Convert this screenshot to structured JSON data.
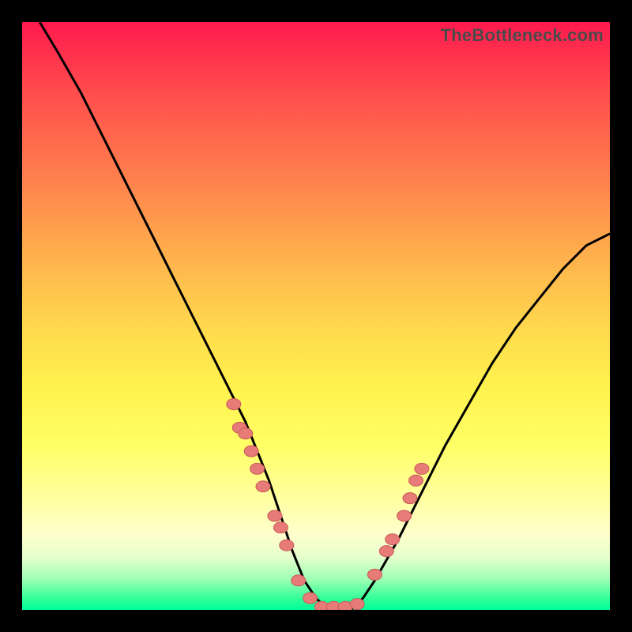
{
  "watermark": "TheBottleneck.com",
  "colors": {
    "curve": "#000000",
    "markers_fill": "#e77b78",
    "markers_stroke": "#c95a57"
  },
  "chart_data": {
    "type": "line",
    "title": "",
    "xlabel": "",
    "ylabel": "",
    "xlim": [
      0,
      100
    ],
    "ylim": [
      0,
      100
    ],
    "grid": false,
    "legend": null,
    "series": [
      {
        "name": "curve",
        "x": [
          3,
          6,
          10,
          14,
          18,
          22,
          26,
          30,
          34,
          38,
          42,
          44,
          46,
          48,
          50,
          52,
          54,
          56,
          58,
          60,
          64,
          68,
          72,
          76,
          80,
          84,
          88,
          92,
          96,
          100
        ],
        "y": [
          100,
          95,
          88,
          80,
          72,
          64,
          56,
          48,
          40,
          32,
          22,
          16,
          10,
          5,
          2,
          0,
          0,
          0,
          2,
          5,
          12,
          20,
          28,
          35,
          42,
          48,
          53,
          58,
          62,
          64
        ],
        "note": "Approximate shape of the V-curve read from the figure; x and y in percent of axis range."
      }
    ],
    "marker_clusters": [
      {
        "name": "left_cluster",
        "points": [
          {
            "x": 36,
            "y": 35
          },
          {
            "x": 37,
            "y": 31
          },
          {
            "x": 38,
            "y": 30
          },
          {
            "x": 39,
            "y": 27
          },
          {
            "x": 40,
            "y": 24
          },
          {
            "x": 41,
            "y": 21
          },
          {
            "x": 43,
            "y": 16
          },
          {
            "x": 44,
            "y": 14
          },
          {
            "x": 45,
            "y": 11
          }
        ]
      },
      {
        "name": "bottom_cluster",
        "points": [
          {
            "x": 47,
            "y": 5
          },
          {
            "x": 49,
            "y": 2
          },
          {
            "x": 51,
            "y": 0.5
          },
          {
            "x": 53,
            "y": 0.5
          },
          {
            "x": 55,
            "y": 0.5
          },
          {
            "x": 57,
            "y": 1
          }
        ]
      },
      {
        "name": "right_cluster",
        "points": [
          {
            "x": 60,
            "y": 6
          },
          {
            "x": 62,
            "y": 10
          },
          {
            "x": 63,
            "y": 12
          },
          {
            "x": 65,
            "y": 16
          },
          {
            "x": 66,
            "y": 19
          },
          {
            "x": 67,
            "y": 22
          },
          {
            "x": 68,
            "y": 24
          }
        ]
      }
    ]
  }
}
